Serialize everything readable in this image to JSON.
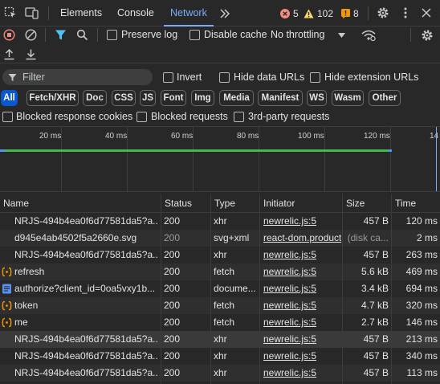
{
  "tabs": {
    "elements": "Elements",
    "console": "Console",
    "network": "Network"
  },
  "badges": {
    "errors": "5",
    "warnings": "102",
    "issues": "8"
  },
  "toolbar": {
    "preserve_log": "Preserve log",
    "disable_cache": "Disable cache",
    "throttling": "No throttling"
  },
  "filter": {
    "placeholder": "Filter",
    "invert": "Invert",
    "hide_data_urls": "Hide data URLs",
    "hide_extension_urls": "Hide extension URLs"
  },
  "type_filters": [
    "All",
    "Fetch/XHR",
    "Doc",
    "CSS",
    "JS",
    "Font",
    "Img",
    "Media",
    "Manifest",
    "WS",
    "Wasm",
    "Other"
  ],
  "blocked": {
    "blocked_response_cookies": "Blocked response cookies",
    "blocked_requests": "Blocked requests",
    "third_party": "3rd-party requests"
  },
  "timeline": {
    "ticks": [
      "20 ms",
      "40 ms",
      "60 ms",
      "80 ms",
      "100 ms",
      "120 ms",
      "14"
    ]
  },
  "table": {
    "headers": {
      "name": "Name",
      "status": "Status",
      "type": "Type",
      "initiator": "Initiator",
      "size": "Size",
      "time": "Time"
    },
    "rows": [
      {
        "name": "NRJS-494b4ea0f6d77581da5?a...",
        "status": "200",
        "type": "xhr",
        "initiator": "newrelic.js:5",
        "size": "457 B",
        "time": "120 ms",
        "icon": "none"
      },
      {
        "name": "d945e4ab4502f5a2660e.svg",
        "status": "200",
        "type": "svg+xml",
        "initiator": "react-dom.product...",
        "size": "(disk ca...",
        "time": "2 ms",
        "icon": "none"
      },
      {
        "name": "NRJS-494b4ea0f6d77581da5?a...",
        "status": "200",
        "type": "xhr",
        "initiator": "newrelic.js:5",
        "size": "457 B",
        "time": "263 ms",
        "icon": "none"
      },
      {
        "name": "refresh",
        "status": "200",
        "type": "fetch",
        "initiator": "newrelic.js:5",
        "size": "5.6 kB",
        "time": "469 ms",
        "icon": "fetch-icon"
      },
      {
        "name": "authorize?client_id=0oa5vxy1b...",
        "status": "200",
        "type": "docume...",
        "initiator": "newrelic.js:5",
        "size": "3.4 kB",
        "time": "694 ms",
        "icon": "document-icon"
      },
      {
        "name": "token",
        "status": "200",
        "type": "fetch",
        "initiator": "newrelic.js:5",
        "size": "4.7 kB",
        "time": "320 ms",
        "icon": "fetch-icon"
      },
      {
        "name": "me",
        "status": "200",
        "type": "fetch",
        "initiator": "newrelic.js:5",
        "size": "2.7 kB",
        "time": "146 ms",
        "icon": "fetch-icon"
      },
      {
        "name": "NRJS-494b4ea0f6d77581da5?a...",
        "status": "200",
        "type": "xhr",
        "initiator": "newrelic.js:5",
        "size": "457 B",
        "time": "213 ms",
        "icon": "none"
      },
      {
        "name": "NRJS-494b4ea0f6d77581da5?a...",
        "status": "200",
        "type": "xhr",
        "initiator": "newrelic.js:5",
        "size": "457 B",
        "time": "340 ms",
        "icon": "none"
      },
      {
        "name": "NRJS-494b4ea0f6d77581da5?a...",
        "status": "200",
        "type": "xhr",
        "initiator": "newrelic.js:5",
        "size": "457 B",
        "time": "113 ms",
        "icon": "none"
      }
    ]
  },
  "colors": {
    "accent": "#7cacf8",
    "selected_pill": "#0b57d0",
    "error": "#f28b82",
    "warning": "#fdd663",
    "issue": "#f29900",
    "record": "#f28b82",
    "timeline_green": "#3fb950",
    "timeline_blue": "#5b8ff0"
  }
}
